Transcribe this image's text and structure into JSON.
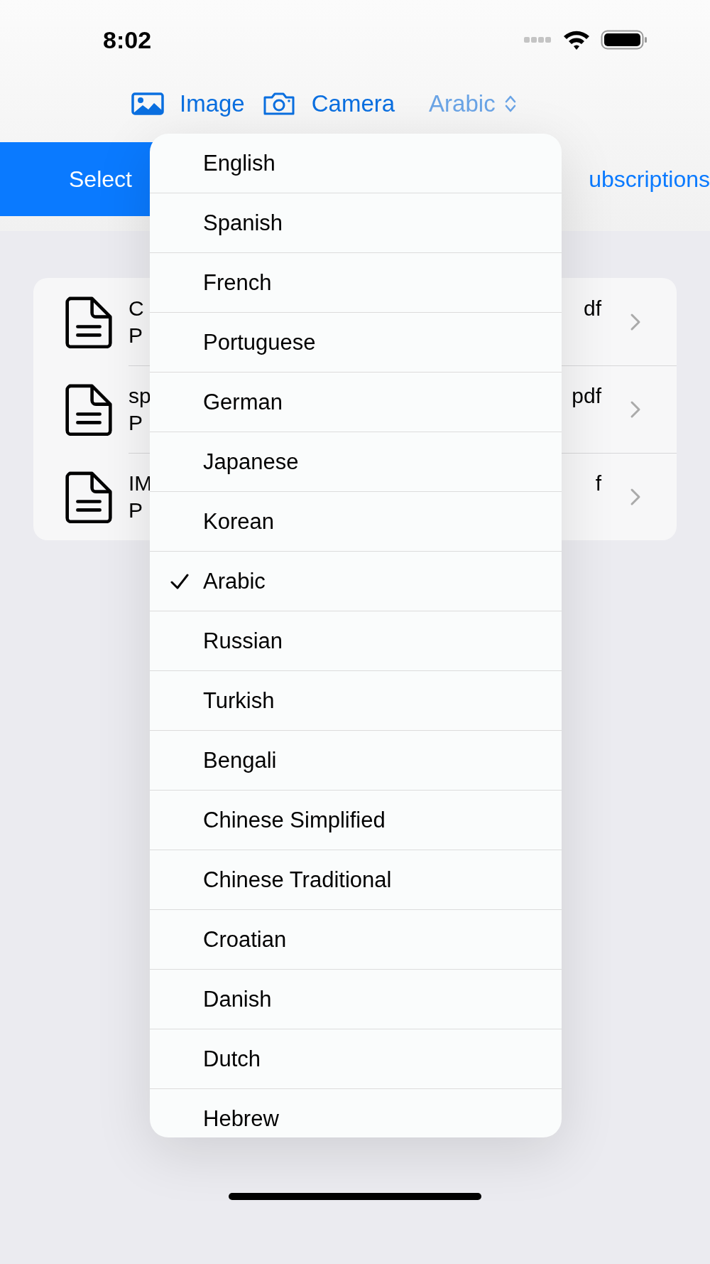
{
  "status_bar": {
    "time": "8:02"
  },
  "toolbar": {
    "image_button": "Image",
    "camera_button": "Camera",
    "language_picker": "Arabic"
  },
  "segments": [
    {
      "label": "Select",
      "selected": true
    },
    {
      "label": "ubscriptions",
      "selected": false
    }
  ],
  "files": [
    {
      "title_start": "C",
      "title_end": "df",
      "subtitle": "P"
    },
    {
      "title_start": "sp",
      "title_end": "pdf",
      "subtitle": "P"
    },
    {
      "title_start": "IM",
      "title_end": "f",
      "subtitle": "P"
    }
  ],
  "language_menu": [
    {
      "label": "English",
      "selected": false
    },
    {
      "label": "Spanish",
      "selected": false
    },
    {
      "label": "French",
      "selected": false
    },
    {
      "label": "Portuguese",
      "selected": false
    },
    {
      "label": "German",
      "selected": false
    },
    {
      "label": "Japanese",
      "selected": false
    },
    {
      "label": "Korean",
      "selected": false
    },
    {
      "label": "Arabic",
      "selected": true
    },
    {
      "label": "Russian",
      "selected": false
    },
    {
      "label": "Turkish",
      "selected": false
    },
    {
      "label": "Bengali",
      "selected": false
    },
    {
      "label": "Chinese Simplified",
      "selected": false
    },
    {
      "label": "Chinese Traditional",
      "selected": false
    },
    {
      "label": "Croatian",
      "selected": false
    },
    {
      "label": "Danish",
      "selected": false
    },
    {
      "label": "Dutch",
      "selected": false
    },
    {
      "label": "Hebrew",
      "selected": false
    }
  ]
}
